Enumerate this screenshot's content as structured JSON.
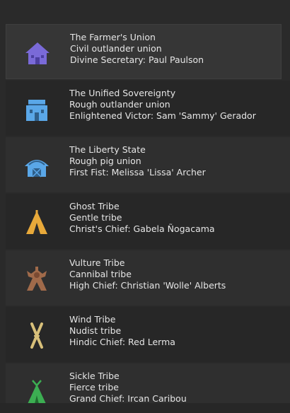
{
  "factions": [
    {
      "name": "The Farmer's Union",
      "type": "Civil outlander union",
      "leader": "Divine Secretary: Paul Paulson",
      "icon": "outlander-house-icon",
      "icon_color": "#7a6ad8"
    },
    {
      "name": "The Unified Sovereignty",
      "type": "Rough outlander union",
      "leader": "Enlightened Victor: Sam 'Sammy' Gerador",
      "icon": "outlander-house-icon",
      "icon_color": "#5aa7e8"
    },
    {
      "name": "The Liberty State",
      "type": "Rough pig union",
      "leader": "First Fist: Melissa 'Lissa' Archer",
      "icon": "pig-union-barn-icon",
      "icon_color": "#5aa7e8"
    },
    {
      "name": "Ghost Tribe",
      "type": "Gentle tribe",
      "leader": "Christ's Chief: Gabela Ñogacama",
      "icon": "tribe-tent-icon",
      "icon_color": "#e8a93a"
    },
    {
      "name": "Vulture Tribe",
      "type": "Cannibal tribe",
      "leader": "High Chief: Christian 'Wolle' Alberts",
      "icon": "cannibal-tribe-icon",
      "icon_color": "#a06a4a"
    },
    {
      "name": "Wind Tribe",
      "type": "Nudist tribe",
      "leader": "Hindic Chief: Red Lerma",
      "icon": "nudist-tribe-icon",
      "icon_color": "#d8c07a"
    },
    {
      "name": "Sickle Tribe",
      "type": "Fierce tribe",
      "leader": "Grand Chief: Ircan Caribou",
      "icon": "fierce-tribe-tent-icon",
      "icon_color": "#3cae52"
    }
  ]
}
